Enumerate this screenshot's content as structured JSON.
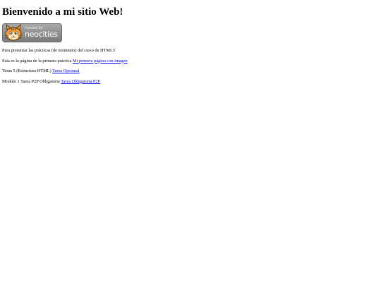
{
  "heading": "Bienvenido a mi sitio Web!",
  "badge": {
    "hosted_by": "hosted by",
    "brand": "neocities",
    "icon": "neocities-cat-icon"
  },
  "lines": [
    {
      "text": "Para presentar las prácticas (de momento) del curso de HTML5",
      "link": ""
    },
    {
      "text": "Esta es la página de la primera práctica ",
      "link": "Mi primera página con imagen"
    },
    {
      "text": "Tema 5 (Estructura HTML) ",
      "link": "Tarea Opcional"
    },
    {
      "text": "Modulo 1 Tarea P2P Obligatoria ",
      "link": "Tarea Obligatoria P2P"
    }
  ],
  "colors": {
    "link": "#0000ee",
    "text": "#000000",
    "background": "#ffffff",
    "badge": "#8a8a8a",
    "cat": "#f29b38"
  }
}
